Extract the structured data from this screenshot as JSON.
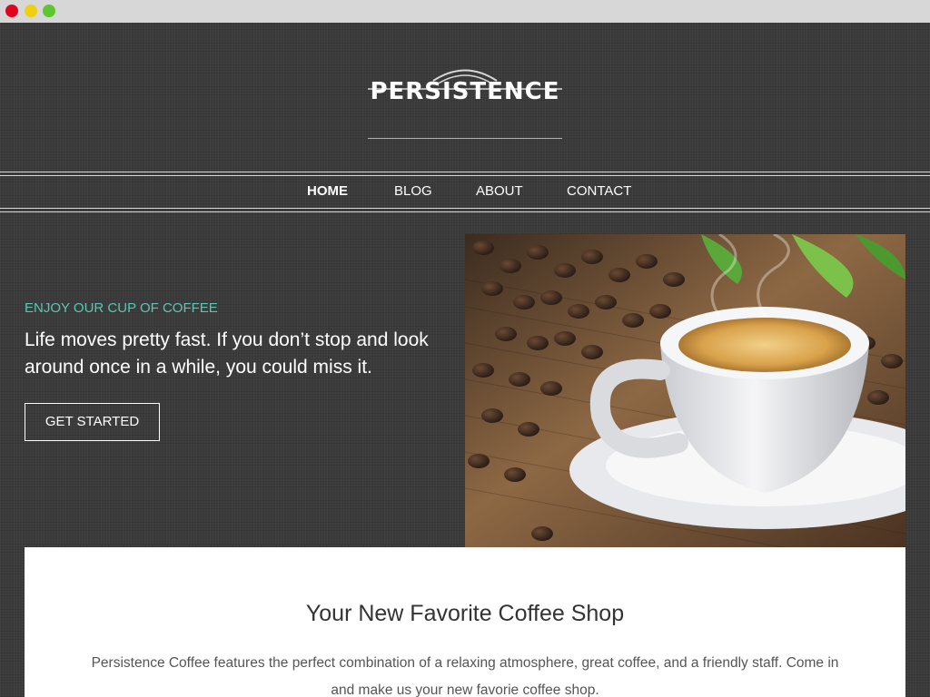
{
  "window": {
    "controls": [
      "close",
      "minimize",
      "maximize"
    ]
  },
  "site": {
    "logo_text": "PERSISTENCE"
  },
  "nav": {
    "items": [
      {
        "label": "HOME",
        "active": true
      },
      {
        "label": "BLOG",
        "active": false
      },
      {
        "label": "ABOUT",
        "active": false
      },
      {
        "label": "CONTACT",
        "active": false
      }
    ]
  },
  "hero": {
    "eyebrow": "ENJOY OUR CUP OF COFFEE",
    "text": "Life moves pretty fast. If you don’t stop and look around once in a while, you could miss it.",
    "button_label": "GET STARTED",
    "image_subject": "coffee-cup-with-beans-and-leaves"
  },
  "content": {
    "title": "Your New Favorite Coffee Shop",
    "body": "Persistence Coffee features the perfect combination of a relaxing atmosphere, great coffee, and a friendly staff. Come in and make us your new favorie coffee shop."
  },
  "colors": {
    "background": "#3b3b3b",
    "accent": "#5cc6b3",
    "text_light": "#ffffff",
    "card": "#ffffff",
    "window_close": "#e0051e",
    "window_minimize": "#f0d00d",
    "window_maximize": "#5ec62e"
  }
}
